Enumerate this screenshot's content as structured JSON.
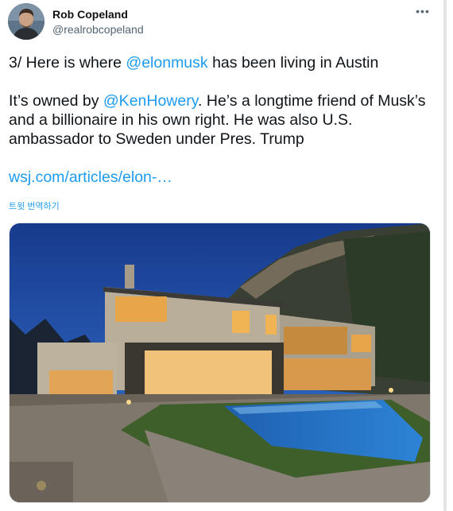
{
  "tweet": {
    "author_name": "Rob Copeland",
    "author_handle": "@realrobcopeland",
    "more_icon": "more-horizontal-icon",
    "line1_prefix": "3/ Here is where ",
    "line1_mention": "@elonmusk",
    "line1_suffix": " has been living in Austin",
    "para2_prefix": "It’s owned by ",
    "para2_mention": "@KenHowery",
    "para2_suffix": ". He’s a longtime friend of Musk’s and a billionaire in his own right. He was also U.S. ambassador to Sweden under Pres. Trump",
    "link_text": "wsj.com/articles/elon-…",
    "translate_label": "트윗 번역하기",
    "accent_color": "#1d9bf0"
  }
}
